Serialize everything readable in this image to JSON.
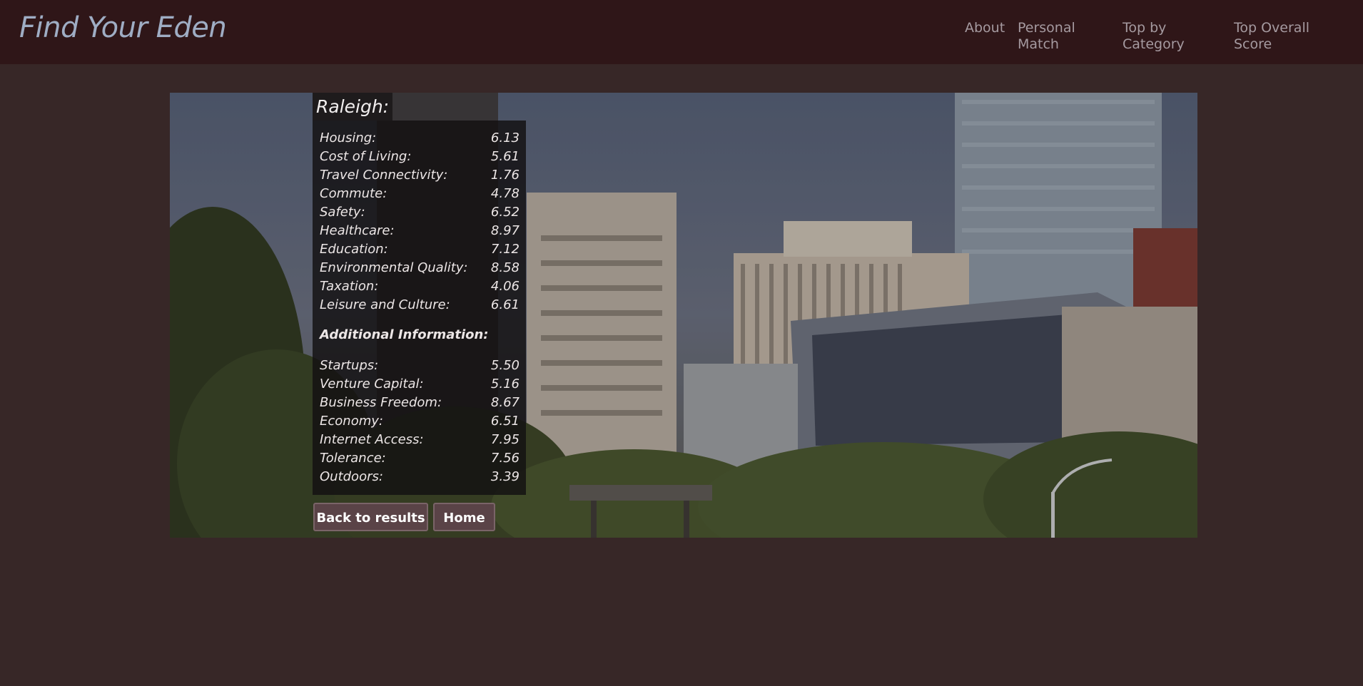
{
  "navbar": {
    "brand": "Find Your Eden",
    "links": [
      {
        "label": "About"
      },
      {
        "label": "Personal Match"
      },
      {
        "label": "Top by Category"
      },
      {
        "label": "Top Overall Score"
      }
    ]
  },
  "city": {
    "title": "Raleigh:",
    "scores": [
      {
        "label": "Housing:",
        "value": "6.13"
      },
      {
        "label": "Cost of Living:",
        "value": "5.61"
      },
      {
        "label": "Travel Connectivity:",
        "value": "1.76"
      },
      {
        "label": "Commute:",
        "value": "4.78"
      },
      {
        "label": "Safety:",
        "value": "6.52"
      },
      {
        "label": "Healthcare:",
        "value": "8.97"
      },
      {
        "label": "Education:",
        "value": "7.12"
      },
      {
        "label": "Environmental Quality:",
        "value": "8.58"
      },
      {
        "label": "Taxation:",
        "value": "4.06"
      },
      {
        "label": "Leisure and Culture:",
        "value": "6.61"
      }
    ],
    "additional_heading": "Additional Information:",
    "additional": [
      {
        "label": "Startups:",
        "value": "5.50"
      },
      {
        "label": "Venture Capital:",
        "value": "5.16"
      },
      {
        "label": "Business Freedom:",
        "value": "8.67"
      },
      {
        "label": "Economy:",
        "value": "6.51"
      },
      {
        "label": "Internet Access:",
        "value": "7.95"
      },
      {
        "label": "Tolerance:",
        "value": "7.56"
      },
      {
        "label": "Outdoors:",
        "value": "3.39"
      }
    ]
  },
  "actions": {
    "back_label": "Back to results",
    "home_label": "Home"
  },
  "colors": {
    "navbar_bg": "#2f1618",
    "page_bg": "#372727",
    "brand": "#9fadc4",
    "nav_link": "#a59aa0",
    "button_bg": "#5a4347"
  }
}
